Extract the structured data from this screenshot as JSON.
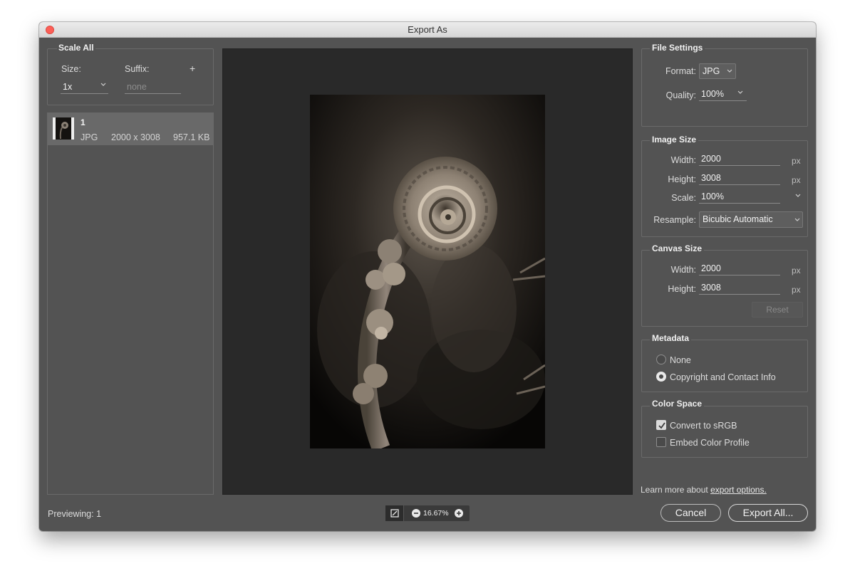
{
  "window": {
    "title": "Export As"
  },
  "scale_all": {
    "title": "Scale All",
    "size_label": "Size:",
    "suffix_label": "Suffix:",
    "add_icon": "+",
    "size_value": "1x",
    "suffix_placeholder": "none"
  },
  "assets": [
    {
      "name": "1",
      "format": "JPG",
      "dimensions": "2000 x 3008",
      "file_size": "957.1 KB"
    }
  ],
  "file_settings": {
    "title": "File Settings",
    "format_label": "Format:",
    "format_value": "JPG",
    "quality_label": "Quality:",
    "quality_value": "100%"
  },
  "image_size": {
    "title": "Image Size",
    "width_label": "Width:",
    "width_value": "2000",
    "height_label": "Height:",
    "height_value": "3008",
    "scale_label": "Scale:",
    "scale_value": "100%",
    "resample_label": "Resample:",
    "resample_value": "Bicubic Automatic",
    "unit": "px"
  },
  "canvas_size": {
    "title": "Canvas Size",
    "width_label": "Width:",
    "width_value": "2000",
    "height_label": "Height:",
    "height_value": "3008",
    "unit": "px",
    "reset_label": "Reset"
  },
  "metadata": {
    "title": "Metadata",
    "options": [
      "None",
      "Copyright and Contact Info"
    ],
    "selected": "Copyright and Contact Info"
  },
  "color_space": {
    "title": "Color Space",
    "convert_label": "Convert to sRGB",
    "convert_checked": true,
    "embed_label": "Embed Color Profile",
    "embed_checked": false
  },
  "learn_more": {
    "text": "Learn more about ",
    "link": "export options."
  },
  "footer": {
    "previewing": "Previewing: 1",
    "zoom": "16.67%",
    "cancel": "Cancel",
    "export_all": "Export All..."
  }
}
